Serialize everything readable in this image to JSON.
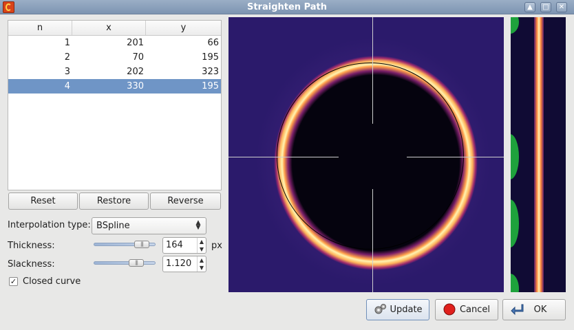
{
  "window": {
    "title": "Straighten Path"
  },
  "table": {
    "columns": [
      "n",
      "x",
      "y"
    ],
    "rows": [
      {
        "n": "1",
        "x": "201",
        "y": "66"
      },
      {
        "n": "2",
        "x": "70",
        "y": "195"
      },
      {
        "n": "3",
        "x": "202",
        "y": "323"
      },
      {
        "n": "4",
        "x": "330",
        "y": "195"
      }
    ],
    "selected_row": 4
  },
  "buttons": {
    "reset": "Reset",
    "restore": "Restore",
    "reverse": "Reverse"
  },
  "interpolation": {
    "label": "Interpolation type:",
    "value": "BSpline"
  },
  "thickness": {
    "label": "Thickness:",
    "value": "164",
    "unit": "px",
    "slider_fraction": 0.85
  },
  "slackness": {
    "label": "Slackness:",
    "value": "1.120",
    "slider_fraction": 0.73
  },
  "closed_curve": {
    "label": "Closed curve",
    "checked": true
  },
  "actions": {
    "update": "Update",
    "cancel": "Cancel",
    "ok": "OK"
  },
  "colors": {
    "titlebar": "#8ca1bc",
    "selection": "#6f95c6",
    "accent_cancel": "#e0201c",
    "ok_arrow": "#4a78b8"
  }
}
